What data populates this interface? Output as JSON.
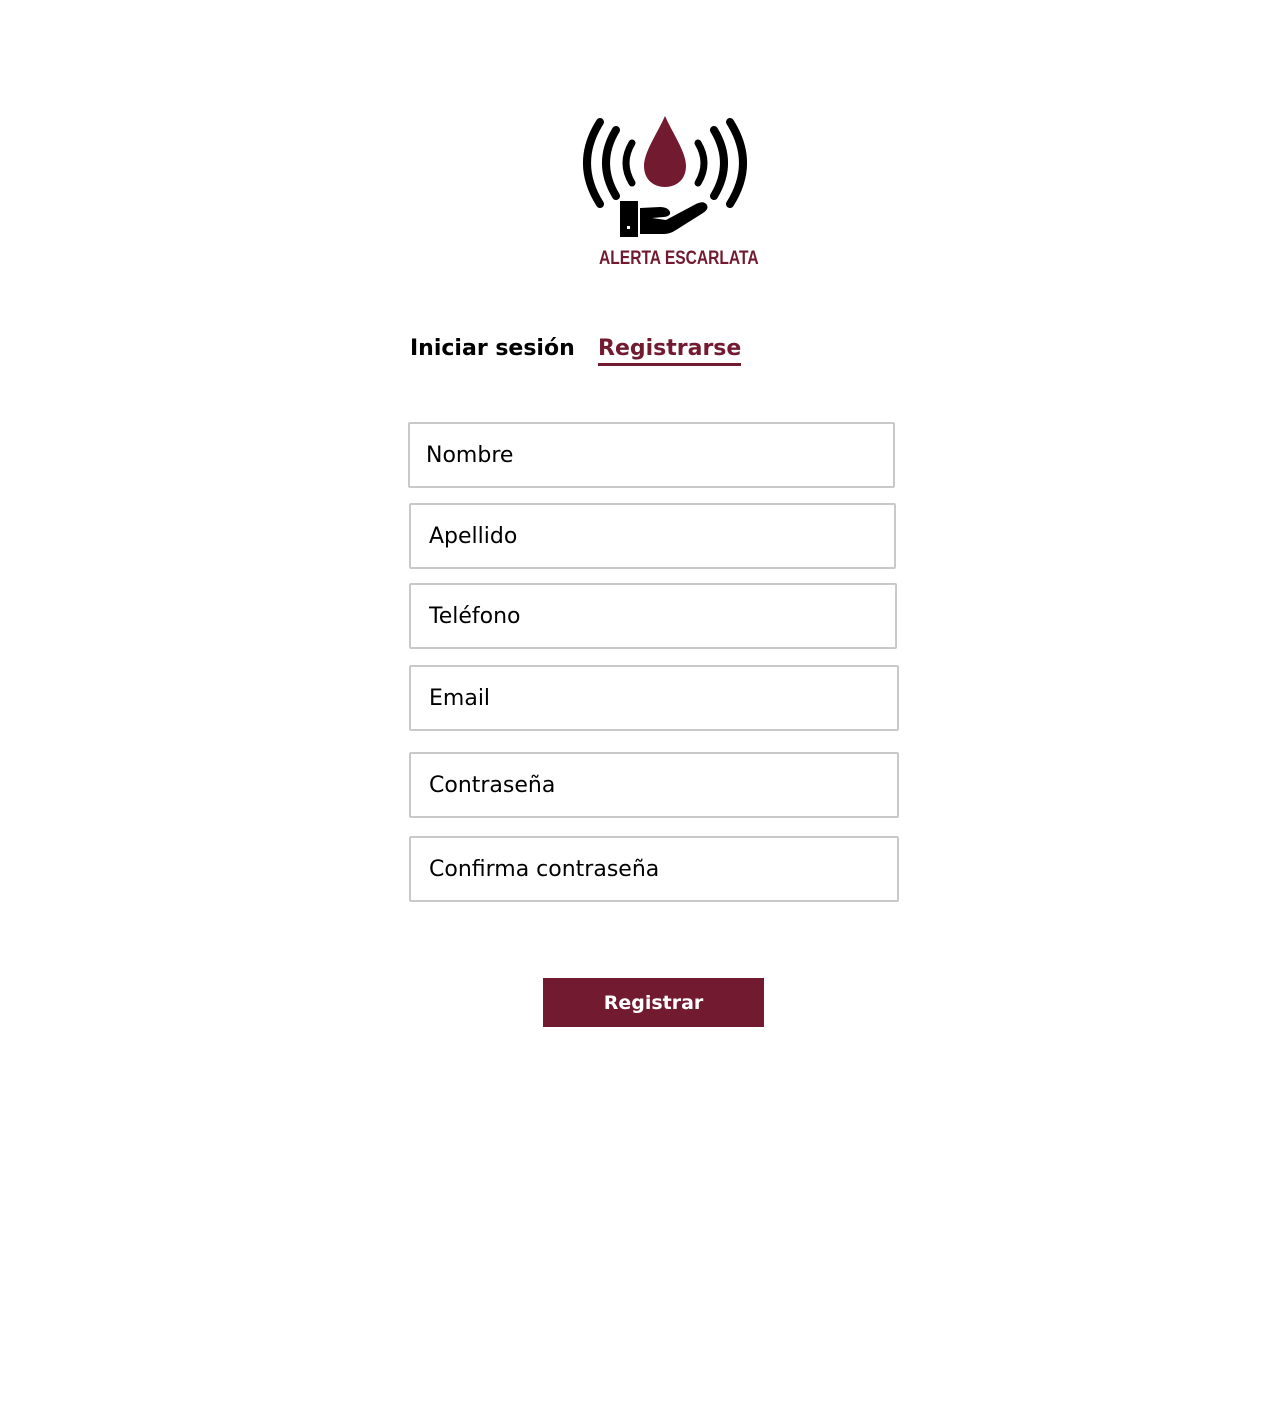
{
  "brand": {
    "name": "ALERTA ESCARLATA",
    "logo_icon": "blood-drop-alert-hand-icon",
    "accent_color": "#721a2f"
  },
  "tabs": [
    {
      "label": "Iniciar sesión",
      "active": false
    },
    {
      "label": "Registrarse",
      "active": true
    }
  ],
  "form": {
    "fields": [
      {
        "placeholder": "Nombre",
        "value": ""
      },
      {
        "placeholder": "Apellido",
        "value": ""
      },
      {
        "placeholder": "Teléfono",
        "value": ""
      },
      {
        "placeholder": "Email",
        "value": ""
      },
      {
        "placeholder": "Contraseña",
        "value": ""
      },
      {
        "placeholder": "Confirma contraseña",
        "value": ""
      }
    ],
    "submit_label": "Registrar"
  }
}
